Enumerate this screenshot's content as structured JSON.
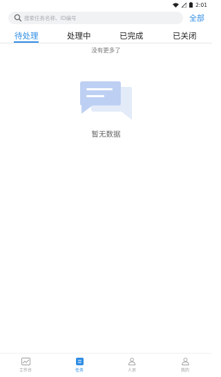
{
  "status_bar": {
    "time": "2:01"
  },
  "search": {
    "placeholder": "搜索任务名称、ID编号",
    "value": ""
  },
  "filter_all_label": "全部",
  "tabs": [
    {
      "label": "待处理",
      "active": true
    },
    {
      "label": "处理中",
      "active": false
    },
    {
      "label": "已完成",
      "active": false
    },
    {
      "label": "已关闭",
      "active": false
    }
  ],
  "list_end_text": "没有更多了",
  "empty_state": {
    "text": "暂无数据"
  },
  "bottom_nav": [
    {
      "label": "工作台",
      "icon": "chart-icon",
      "active": false
    },
    {
      "label": "任务",
      "icon": "task-icon",
      "active": true
    },
    {
      "label": "人员",
      "icon": "people-icon",
      "active": false
    },
    {
      "label": "我的",
      "icon": "profile-icon",
      "active": false
    }
  ],
  "colors": {
    "accent": "#2f8de4",
    "text": "#222222",
    "muted": "#999999"
  }
}
